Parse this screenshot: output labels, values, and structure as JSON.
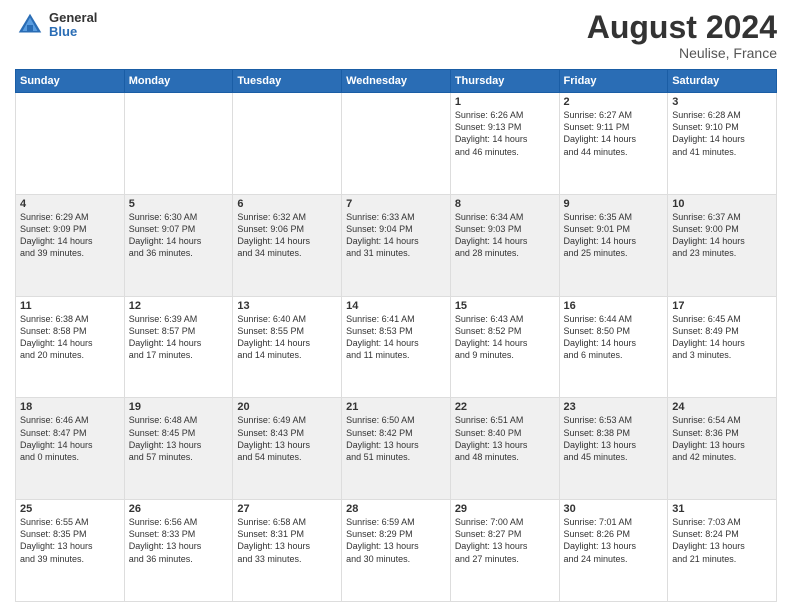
{
  "header": {
    "logo_general": "General",
    "logo_blue": "Blue",
    "month_year": "August 2024",
    "location": "Neulise, France"
  },
  "days_of_week": [
    "Sunday",
    "Monday",
    "Tuesday",
    "Wednesday",
    "Thursday",
    "Friday",
    "Saturday"
  ],
  "weeks": [
    [
      {
        "num": "",
        "info": ""
      },
      {
        "num": "",
        "info": ""
      },
      {
        "num": "",
        "info": ""
      },
      {
        "num": "",
        "info": ""
      },
      {
        "num": "1",
        "info": "Sunrise: 6:26 AM\nSunset: 9:13 PM\nDaylight: 14 hours\nand 46 minutes."
      },
      {
        "num": "2",
        "info": "Sunrise: 6:27 AM\nSunset: 9:11 PM\nDaylight: 14 hours\nand 44 minutes."
      },
      {
        "num": "3",
        "info": "Sunrise: 6:28 AM\nSunset: 9:10 PM\nDaylight: 14 hours\nand 41 minutes."
      }
    ],
    [
      {
        "num": "4",
        "info": "Sunrise: 6:29 AM\nSunset: 9:09 PM\nDaylight: 14 hours\nand 39 minutes."
      },
      {
        "num": "5",
        "info": "Sunrise: 6:30 AM\nSunset: 9:07 PM\nDaylight: 14 hours\nand 36 minutes."
      },
      {
        "num": "6",
        "info": "Sunrise: 6:32 AM\nSunset: 9:06 PM\nDaylight: 14 hours\nand 34 minutes."
      },
      {
        "num": "7",
        "info": "Sunrise: 6:33 AM\nSunset: 9:04 PM\nDaylight: 14 hours\nand 31 minutes."
      },
      {
        "num": "8",
        "info": "Sunrise: 6:34 AM\nSunset: 9:03 PM\nDaylight: 14 hours\nand 28 minutes."
      },
      {
        "num": "9",
        "info": "Sunrise: 6:35 AM\nSunset: 9:01 PM\nDaylight: 14 hours\nand 25 minutes."
      },
      {
        "num": "10",
        "info": "Sunrise: 6:37 AM\nSunset: 9:00 PM\nDaylight: 14 hours\nand 23 minutes."
      }
    ],
    [
      {
        "num": "11",
        "info": "Sunrise: 6:38 AM\nSunset: 8:58 PM\nDaylight: 14 hours\nand 20 minutes."
      },
      {
        "num": "12",
        "info": "Sunrise: 6:39 AM\nSunset: 8:57 PM\nDaylight: 14 hours\nand 17 minutes."
      },
      {
        "num": "13",
        "info": "Sunrise: 6:40 AM\nSunset: 8:55 PM\nDaylight: 14 hours\nand 14 minutes."
      },
      {
        "num": "14",
        "info": "Sunrise: 6:41 AM\nSunset: 8:53 PM\nDaylight: 14 hours\nand 11 minutes."
      },
      {
        "num": "15",
        "info": "Sunrise: 6:43 AM\nSunset: 8:52 PM\nDaylight: 14 hours\nand 9 minutes."
      },
      {
        "num": "16",
        "info": "Sunrise: 6:44 AM\nSunset: 8:50 PM\nDaylight: 14 hours\nand 6 minutes."
      },
      {
        "num": "17",
        "info": "Sunrise: 6:45 AM\nSunset: 8:49 PM\nDaylight: 14 hours\nand 3 minutes."
      }
    ],
    [
      {
        "num": "18",
        "info": "Sunrise: 6:46 AM\nSunset: 8:47 PM\nDaylight: 14 hours\nand 0 minutes."
      },
      {
        "num": "19",
        "info": "Sunrise: 6:48 AM\nSunset: 8:45 PM\nDaylight: 13 hours\nand 57 minutes."
      },
      {
        "num": "20",
        "info": "Sunrise: 6:49 AM\nSunset: 8:43 PM\nDaylight: 13 hours\nand 54 minutes."
      },
      {
        "num": "21",
        "info": "Sunrise: 6:50 AM\nSunset: 8:42 PM\nDaylight: 13 hours\nand 51 minutes."
      },
      {
        "num": "22",
        "info": "Sunrise: 6:51 AM\nSunset: 8:40 PM\nDaylight: 13 hours\nand 48 minutes."
      },
      {
        "num": "23",
        "info": "Sunrise: 6:53 AM\nSunset: 8:38 PM\nDaylight: 13 hours\nand 45 minutes."
      },
      {
        "num": "24",
        "info": "Sunrise: 6:54 AM\nSunset: 8:36 PM\nDaylight: 13 hours\nand 42 minutes."
      }
    ],
    [
      {
        "num": "25",
        "info": "Sunrise: 6:55 AM\nSunset: 8:35 PM\nDaylight: 13 hours\nand 39 minutes."
      },
      {
        "num": "26",
        "info": "Sunrise: 6:56 AM\nSunset: 8:33 PM\nDaylight: 13 hours\nand 36 minutes."
      },
      {
        "num": "27",
        "info": "Sunrise: 6:58 AM\nSunset: 8:31 PM\nDaylight: 13 hours\nand 33 minutes."
      },
      {
        "num": "28",
        "info": "Sunrise: 6:59 AM\nSunset: 8:29 PM\nDaylight: 13 hours\nand 30 minutes."
      },
      {
        "num": "29",
        "info": "Sunrise: 7:00 AM\nSunset: 8:27 PM\nDaylight: 13 hours\nand 27 minutes."
      },
      {
        "num": "30",
        "info": "Sunrise: 7:01 AM\nSunset: 8:26 PM\nDaylight: 13 hours\nand 24 minutes."
      },
      {
        "num": "31",
        "info": "Sunrise: 7:03 AM\nSunset: 8:24 PM\nDaylight: 13 hours\nand 21 minutes."
      }
    ]
  ]
}
